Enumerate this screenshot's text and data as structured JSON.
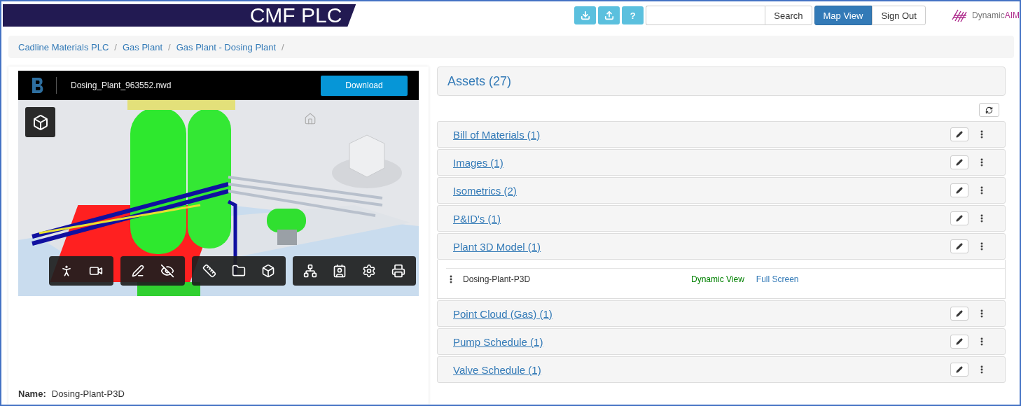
{
  "header": {
    "title": "CMF PLC",
    "help_button": "?",
    "search_button": "Search",
    "nav": [
      {
        "label": "Map View",
        "selected": true
      },
      {
        "label": "Sign Out",
        "selected": false
      }
    ],
    "logo": "Dynamic**AIM**"
  },
  "breadcrumb": {
    "items": [
      {
        "label": "Cadline Materials PLC",
        "separator": "/"
      },
      {
        "label": "Gas Plant",
        "separator": "/"
      },
      {
        "label": "Gas Plant - Dosing Plant",
        "separator": "/"
      }
    ]
  },
  "viewer": {
    "file_name": "Dosing_Plant_963552.nwd",
    "download_button": "Download"
  },
  "details": {
    "label": "Name:",
    "value": "Dosing-Plant-P3D"
  },
  "assets": {
    "title": "Assets (27)",
    "groups": [
      {
        "label": "Bill of Materials (1)",
        "expanded": false
      },
      {
        "label": "Images (1)",
        "expanded": false
      },
      {
        "label": "Isometrics (2)",
        "expanded": false
      },
      {
        "label": "P&ID's (1)",
        "expanded": false
      },
      {
        "label": "Plant 3D Model (1)",
        "expanded": true,
        "items": [
          {
            "name": "Dosing-Plant-P3D",
            "links": [
              {
                "label": "Dynamic View",
                "color": "#008000"
              },
              {
                "label": "Full Screen",
                "color": "#337ab7"
              }
            ]
          }
        ]
      },
      {
        "label": "Point Cloud (Gas) (1)",
        "expanded": false
      },
      {
        "label": "Pump Schedule (1)",
        "expanded": false
      },
      {
        "label": "Valve Schedule (1)",
        "expanded": false
      }
    ]
  }
}
